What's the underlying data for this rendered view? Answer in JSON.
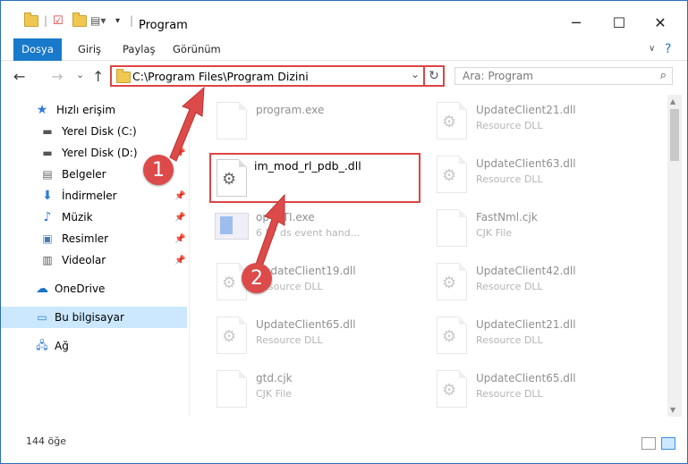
{
  "window": {
    "title": "Program",
    "minimize": "─",
    "maximize": "☐",
    "close": "✕"
  },
  "ribbon": {
    "tabs": [
      "Dosya",
      "Giriş",
      "Paylaş",
      "Görünüm"
    ]
  },
  "nav": {
    "back": "←",
    "forward": "→",
    "recent": "⌄",
    "up": "↑"
  },
  "address": {
    "path": "C:\\Program Files\\Program Dizini",
    "dropdown": "⌄",
    "refresh": "↻"
  },
  "search": {
    "placeholder": "Ara: Program",
    "icon": "⌕"
  },
  "sidebar": {
    "items": [
      {
        "label": "Hızlı erişim",
        "icon": "star-icon"
      },
      {
        "label": "Yerel Disk (C:)",
        "icon": "drive-icon"
      },
      {
        "label": "Yerel Disk (D:)",
        "icon": "drive-icon"
      },
      {
        "label": "Belgeler",
        "icon": "documents-icon"
      },
      {
        "label": "İndirmeler",
        "icon": "download-icon"
      },
      {
        "label": "Müzik",
        "icon": "music-icon"
      },
      {
        "label": "Resimler",
        "icon": "pictures-icon"
      },
      {
        "label": "Videolar",
        "icon": "videos-icon"
      },
      {
        "label": "OneDrive",
        "icon": "cloud-icon"
      },
      {
        "label": "Bu bilgisayar",
        "icon": "computer-icon"
      },
      {
        "label": "Ağ",
        "icon": "network-icon"
      }
    ]
  },
  "files": {
    "left": [
      {
        "name": "program.exe",
        "desc": ""
      },
      {
        "name": "im_mod_rl_pdb_.dll",
        "desc": ""
      },
      {
        "name": "opy5TI.exe",
        "desc": "6 FY ds event hand..."
      },
      {
        "name": "UpdateClient19.dll",
        "desc": "Resource DLL"
      },
      {
        "name": "UpdateClient65.dll",
        "desc": "Resource DLL"
      },
      {
        "name": "gtd.cjk",
        "desc": "CJK File"
      }
    ],
    "right": [
      {
        "name": "UpdateClient21.dll",
        "desc": "Resource DLL"
      },
      {
        "name": "UpdateClient63.dll",
        "desc": "Resource DLL"
      },
      {
        "name": "FastNml.cjk",
        "desc": "CJK File"
      },
      {
        "name": "UpdateClient42.dll",
        "desc": "Resource DLL"
      },
      {
        "name": "UpdateClient21.dll",
        "desc": "Resource DLL"
      },
      {
        "name": "UpdateClient65.dll",
        "desc": "Resource DLL"
      }
    ]
  },
  "status": {
    "count": "144 öğe"
  },
  "badges": {
    "one": "1",
    "two": "2"
  },
  "colors": {
    "accent": "#1979ca",
    "highlight": "#dd4a4a",
    "selection": "#cce8ff"
  }
}
